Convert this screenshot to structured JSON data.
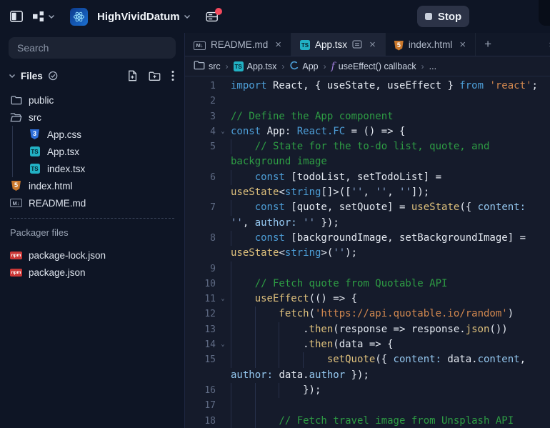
{
  "colors": {
    "kw": "#4d9ed7",
    "pl": "#e3e8f0",
    "cm": "#2e9d44",
    "str": "#d2884f",
    "fn": "#dec07c",
    "ty": "#4d9ed7",
    "prop": "#94c7ef",
    "es": "#8aa6cf",
    "accent_red": "#f4495d",
    "ts": "#22b1c4",
    "css": "#2e6fd9",
    "html": "#c9772b",
    "npm": "#cb3837"
  },
  "topbar": {
    "title": "HighVividDatum",
    "stop_label": "Stop"
  },
  "sidebar": {
    "search_placeholder": "Search",
    "files_header": "Files",
    "tree": [
      {
        "label": "public",
        "icon": "folder",
        "nested": false
      },
      {
        "label": "src",
        "icon": "folder-open",
        "nested": false
      },
      {
        "label": "App.css",
        "icon": "css",
        "nested": true
      },
      {
        "label": "App.tsx",
        "icon": "ts",
        "nested": true
      },
      {
        "label": "index.tsx",
        "icon": "ts",
        "nested": true
      },
      {
        "label": "index.html",
        "icon": "html",
        "nested": false
      },
      {
        "label": "README.md",
        "icon": "md",
        "nested": false
      }
    ],
    "packager_header": "Packager files",
    "packager": [
      {
        "label": "package-lock.json",
        "icon": "npm"
      },
      {
        "label": "package.json",
        "icon": "npm"
      }
    ]
  },
  "tabs": [
    {
      "label": "README.md",
      "icon": "md",
      "active": false,
      "extra_icon": false
    },
    {
      "label": "App.tsx",
      "icon": "ts",
      "active": true,
      "extra_icon": true
    },
    {
      "label": "index.html",
      "icon": "html",
      "active": false,
      "extra_icon": false
    }
  ],
  "new_tab_label": "+",
  "breadcrumb": [
    {
      "label": "src",
      "icon": "folder"
    },
    {
      "label": "App.tsx",
      "icon": "ts-mini"
    },
    {
      "label": "App",
      "icon": "component"
    },
    {
      "label": "useEffect() callback",
      "icon": "function"
    },
    {
      "label": "...",
      "icon": null
    }
  ],
  "editor": {
    "rows": [
      {
        "num": "1",
        "fold": false,
        "ind": 0,
        "seg": [
          [
            "kw",
            "import"
          ],
          [
            "pl",
            " React, { useState, useEffect } "
          ],
          [
            "kw",
            "from"
          ],
          [
            "pl",
            " "
          ],
          [
            "str",
            "'react'"
          ],
          [
            "pl",
            ";"
          ]
        ]
      },
      {
        "num": "2",
        "fold": false,
        "ind": 0,
        "seg": []
      },
      {
        "num": "3",
        "fold": false,
        "ind": 0,
        "seg": [
          [
            "cm",
            "// Define the App component"
          ]
        ]
      },
      {
        "num": "4",
        "fold": true,
        "ind": 0,
        "seg": [
          [
            "kw",
            "const"
          ],
          [
            "pl",
            " App: "
          ],
          [
            "ty",
            "React.FC"
          ],
          [
            "pl",
            " = () => {"
          ]
        ]
      },
      {
        "num": "5",
        "fold": false,
        "ind": 1,
        "seg": [
          [
            "cm",
            "// State for the to-do list, quote, and"
          ]
        ]
      },
      {
        "num": "",
        "fold": false,
        "ind": 0,
        "seg": [
          [
            "cm",
            "background image"
          ]
        ]
      },
      {
        "num": "6",
        "fold": false,
        "ind": 1,
        "seg": [
          [
            "kw",
            "const"
          ],
          [
            "pl",
            " [todoList, setTodoList] ="
          ]
        ]
      },
      {
        "num": "",
        "fold": false,
        "ind": 0,
        "seg": [
          [
            "fn",
            "useState"
          ],
          [
            "pl",
            "<"
          ],
          [
            "ty",
            "string"
          ],
          [
            "pl",
            "[]>(["
          ],
          [
            "es",
            "''"
          ],
          [
            "pl",
            ", "
          ],
          [
            "es",
            "''"
          ],
          [
            "pl",
            ", "
          ],
          [
            "es",
            "''"
          ],
          [
            "pl",
            "]);"
          ]
        ]
      },
      {
        "num": "7",
        "fold": false,
        "ind": 1,
        "seg": [
          [
            "kw",
            "const"
          ],
          [
            "pl",
            " [quote, setQuote] = "
          ],
          [
            "fn",
            "useState"
          ],
          [
            "pl",
            "({ "
          ],
          [
            "prop",
            "content:"
          ]
        ]
      },
      {
        "num": "",
        "fold": false,
        "ind": 0,
        "seg": [
          [
            "es",
            "''"
          ],
          [
            "pl",
            ", "
          ],
          [
            "prop",
            "author:"
          ],
          [
            "pl",
            " "
          ],
          [
            "es",
            "''"
          ],
          [
            "pl",
            " });"
          ]
        ]
      },
      {
        "num": "8",
        "fold": false,
        "ind": 1,
        "seg": [
          [
            "kw",
            "const"
          ],
          [
            "pl",
            " [backgroundImage, setBackgroundImage] ="
          ]
        ]
      },
      {
        "num": "",
        "fold": false,
        "ind": 0,
        "seg": [
          [
            "fn",
            "useState"
          ],
          [
            "pl",
            "<"
          ],
          [
            "ty",
            "string"
          ],
          [
            "pl",
            ">("
          ],
          [
            "es",
            "''"
          ],
          [
            "pl",
            ");"
          ]
        ]
      },
      {
        "num": "9",
        "fold": false,
        "ind": 1,
        "seg": []
      },
      {
        "num": "10",
        "fold": false,
        "ind": 1,
        "seg": [
          [
            "cm",
            "// Fetch quote from Quotable API"
          ]
        ]
      },
      {
        "num": "11",
        "fold": true,
        "ind": 1,
        "seg": [
          [
            "fn",
            "useEffect"
          ],
          [
            "pl",
            "(() => {"
          ]
        ]
      },
      {
        "num": "12",
        "fold": false,
        "ind": 2,
        "seg": [
          [
            "fn",
            "fetch"
          ],
          [
            "pl",
            "("
          ],
          [
            "str",
            "'https://api.quotable.io/random'"
          ],
          [
            "pl",
            ")"
          ]
        ]
      },
      {
        "num": "13",
        "fold": false,
        "ind": 3,
        "seg": [
          [
            "pl",
            "."
          ],
          [
            "fn",
            "then"
          ],
          [
            "pl",
            "(response => response."
          ],
          [
            "fn",
            "json"
          ],
          [
            "pl",
            "())"
          ]
        ]
      },
      {
        "num": "14",
        "fold": true,
        "ind": 3,
        "seg": [
          [
            "pl",
            "."
          ],
          [
            "fn",
            "then"
          ],
          [
            "pl",
            "(data => {"
          ]
        ]
      },
      {
        "num": "15",
        "fold": false,
        "ind": 4,
        "seg": [
          [
            "fn",
            "setQuote"
          ],
          [
            "pl",
            "({ "
          ],
          [
            "prop",
            "content:"
          ],
          [
            "pl",
            " data."
          ],
          [
            "prop",
            "content"
          ],
          [
            "pl",
            ","
          ]
        ]
      },
      {
        "num": "",
        "fold": false,
        "ind": 0,
        "seg": [
          [
            "prop",
            "author:"
          ],
          [
            "pl",
            " data."
          ],
          [
            "prop",
            "author"
          ],
          [
            "pl",
            " });"
          ]
        ]
      },
      {
        "num": "16",
        "fold": false,
        "ind": 3,
        "seg": [
          [
            "pl",
            "});"
          ]
        ]
      },
      {
        "num": "17",
        "fold": false,
        "ind": 2,
        "seg": []
      },
      {
        "num": "18",
        "fold": false,
        "ind": 2,
        "seg": [
          [
            "cm",
            "// Fetch travel image from Unsplash API"
          ]
        ]
      }
    ]
  }
}
